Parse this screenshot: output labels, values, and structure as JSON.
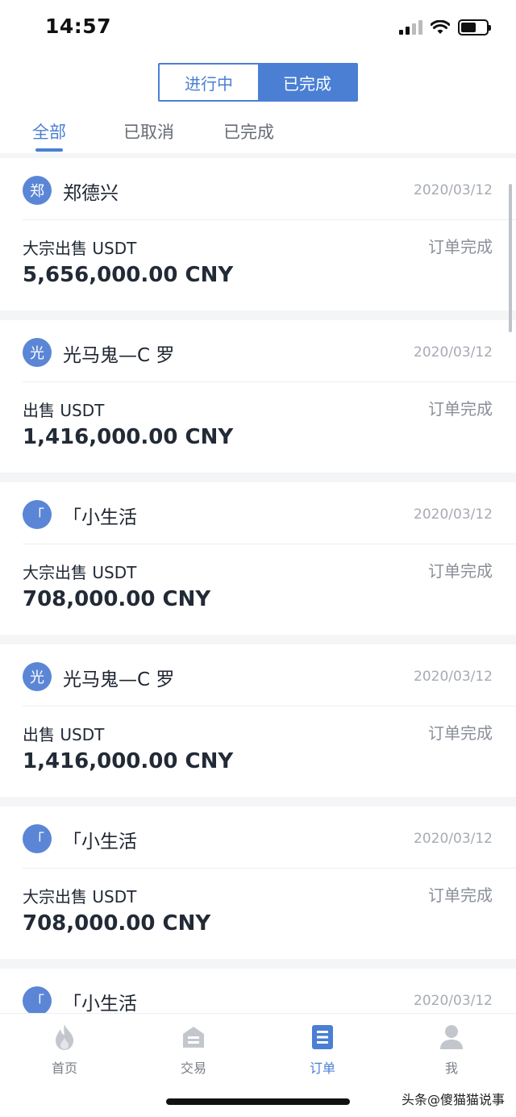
{
  "status_bar": {
    "time": "14:57"
  },
  "segmented": {
    "in_progress": "进行中",
    "completed": "已完成"
  },
  "filter_tabs": [
    {
      "label": "全部"
    },
    {
      "label": "已取消"
    },
    {
      "label": "已完成"
    }
  ],
  "orders": [
    {
      "avatar": "郑",
      "name": "郑德兴",
      "date": "2020/03/12",
      "type": "大宗出售 USDT",
      "status": "订单完成",
      "amount": "5,656,000.00 CNY"
    },
    {
      "avatar": "光",
      "name": "光马鬼—C 罗",
      "date": "2020/03/12",
      "type": "出售 USDT",
      "status": "订单完成",
      "amount": "1,416,000.00 CNY"
    },
    {
      "avatar": "「",
      "name": "「小生活",
      "date": "2020/03/12",
      "type": "大宗出售 USDT",
      "status": "订单完成",
      "amount": "708,000.00 CNY"
    },
    {
      "avatar": "光",
      "name": "光马鬼—C 罗",
      "date": "2020/03/12",
      "type": "出售 USDT",
      "status": "订单完成",
      "amount": "1,416,000.00 CNY"
    },
    {
      "avatar": "「",
      "name": "「小生活",
      "date": "2020/03/12",
      "type": "大宗出售 USDT",
      "status": "订单完成",
      "amount": "708,000.00 CNY"
    },
    {
      "avatar": "「",
      "name": "「小生活",
      "date": "2020/03/12",
      "type": "",
      "status": "",
      "amount": ""
    }
  ],
  "bottom_nav": [
    {
      "label": "首页",
      "icon": "flame-icon"
    },
    {
      "label": "交易",
      "icon": "trade-icon"
    },
    {
      "label": "订单",
      "icon": "order-list-icon"
    },
    {
      "label": "我",
      "icon": "user-icon"
    }
  ],
  "watermark": "头条@傻猫猫说事",
  "colors": {
    "accent": "#4a7fd4",
    "avatar": "#5b86d6",
    "muted": "#8a9099"
  }
}
